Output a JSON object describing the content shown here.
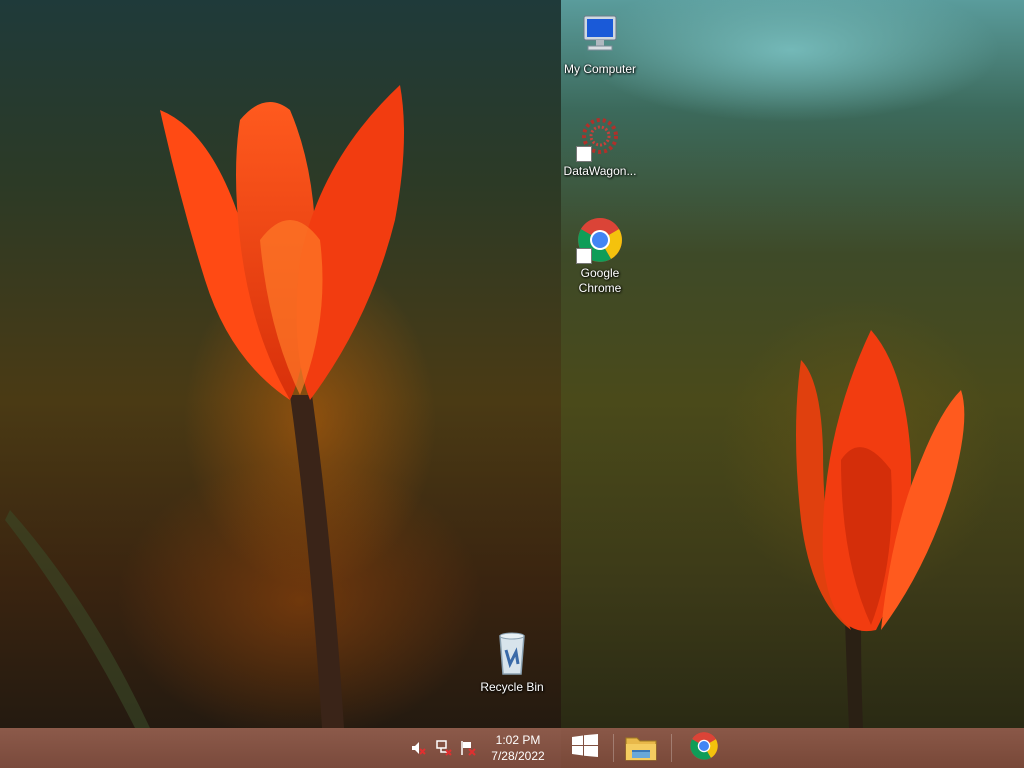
{
  "desktop": {
    "icons": [
      {
        "label": "My Computer",
        "icon": "computer-icon"
      },
      {
        "label": "DataWagon...",
        "icon": "datawagon-icon"
      },
      {
        "label": "Google Chrome",
        "icon": "chrome-icon"
      },
      {
        "label": "Recycle Bin",
        "icon": "recycle-bin-icon"
      }
    ]
  },
  "taskbar": {
    "clock": {
      "time": "1:02 PM",
      "date": "7/28/2022"
    },
    "tray": [
      "volume-muted-icon",
      "network-icon",
      "action-center-flag-icon"
    ],
    "buttons": [
      {
        "icon": "windows-start-icon"
      },
      {
        "icon": "file-explorer-icon"
      },
      {
        "icon": "chrome-icon"
      }
    ]
  },
  "colors": {
    "taskbar": "#7a4a3c",
    "tulip": "#f04a14",
    "chrome_red": "#db4437",
    "chrome_green": "#0f9d58",
    "chrome_yellow": "#f4c20d",
    "chrome_blue": "#4285f4"
  }
}
